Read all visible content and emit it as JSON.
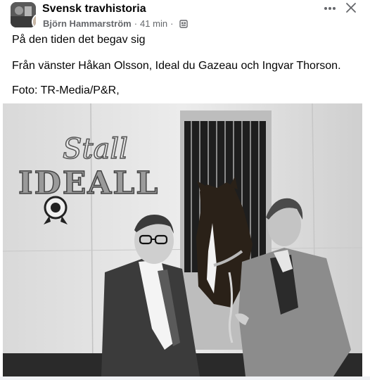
{
  "header": {
    "group_name": "Svensk travhistoria",
    "author": "Björn Hammarström",
    "separator": "·",
    "time": "41 min",
    "audience_icon": "group-privacy-icon",
    "more_icon": "more-dots-icon",
    "close_icon": "close-icon"
  },
  "post": {
    "lines": [
      "På den tiden det begav sig",
      "Från vänster Håkan Olsson, Ideal du Gazeau och Ingvar Thorson.",
      "Foto: TR-Media/P&R,"
    ]
  },
  "photo": {
    "sign_script": "Stall",
    "sign_block": "IDEALL"
  },
  "colors": {
    "text": "#050505",
    "secondary": "#65676b"
  }
}
